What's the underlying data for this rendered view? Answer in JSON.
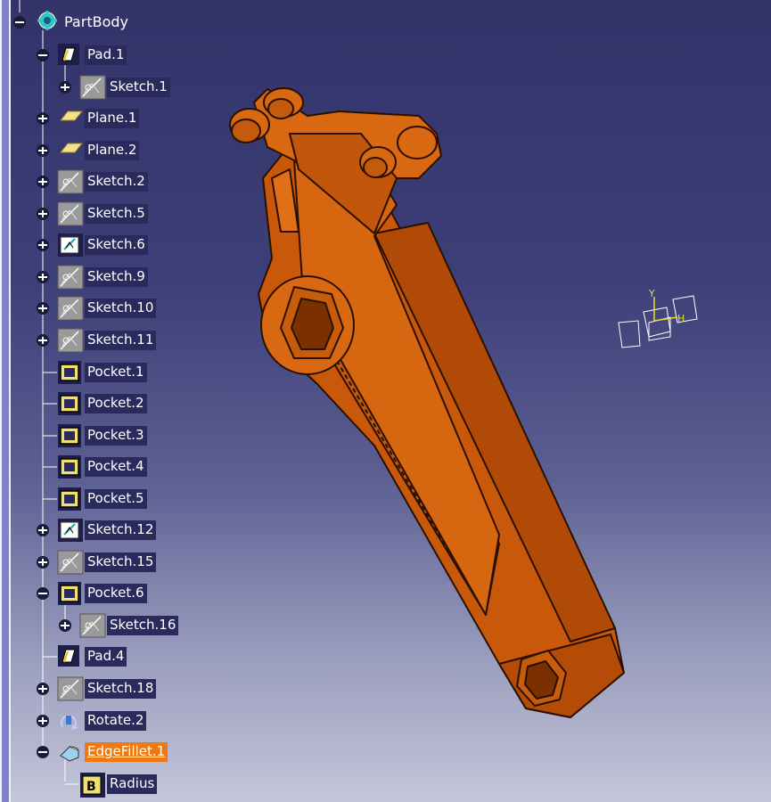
{
  "tree": {
    "root": {
      "label": "PartBody",
      "icon": "partbody-icon"
    },
    "nodes": [
      {
        "label": "Pad.1",
        "icon": "pad-icon",
        "expander": "minus"
      },
      {
        "label": "Sketch.1",
        "icon": "sketch-icon",
        "expander": "plus"
      },
      {
        "label": "Plane.1",
        "icon": "plane-icon",
        "expander": "plus"
      },
      {
        "label": "Plane.2",
        "icon": "plane-icon",
        "expander": "plus"
      },
      {
        "label": "Sketch.2",
        "icon": "sketch-icon",
        "expander": "plus"
      },
      {
        "label": "Sketch.5",
        "icon": "sketch-icon",
        "expander": "plus"
      },
      {
        "label": "Sketch.6",
        "icon": "sketch-edit-icon",
        "expander": "plus"
      },
      {
        "label": "Sketch.9",
        "icon": "sketch-icon",
        "expander": "plus"
      },
      {
        "label": "Sketch.10",
        "icon": "sketch-icon",
        "expander": "plus"
      },
      {
        "label": "Sketch.11",
        "icon": "sketch-icon",
        "expander": "plus"
      },
      {
        "label": "Pocket.1",
        "icon": "pocket-icon",
        "expander": "none"
      },
      {
        "label": "Pocket.2",
        "icon": "pocket-icon",
        "expander": "none"
      },
      {
        "label": "Pocket.3",
        "icon": "pocket-icon",
        "expander": "none"
      },
      {
        "label": "Pocket.4",
        "icon": "pocket-icon",
        "expander": "none"
      },
      {
        "label": "Pocket.5",
        "icon": "pocket-icon",
        "expander": "none"
      },
      {
        "label": "Sketch.12",
        "icon": "sketch-edit-icon",
        "expander": "plus"
      },
      {
        "label": "Sketch.15",
        "icon": "sketch-icon",
        "expander": "plus"
      },
      {
        "label": "Pocket.6",
        "icon": "pocket-icon",
        "expander": "minus"
      },
      {
        "label": "Sketch.16",
        "icon": "sketch-icon",
        "expander": "plus"
      },
      {
        "label": "Pad.4",
        "icon": "pad-icon",
        "expander": "none"
      },
      {
        "label": "Sketch.18",
        "icon": "sketch-icon",
        "expander": "plus"
      },
      {
        "label": "Rotate.2",
        "icon": "rotate-icon",
        "expander": "plus"
      },
      {
        "label": "EdgeFillet.1",
        "icon": "edge-fillet-icon",
        "expander": "minus",
        "selected": true
      },
      {
        "label": "Radius",
        "icon": "radius-parameter-icon",
        "expander": "none"
      }
    ]
  },
  "compass": {
    "axis_labels": [
      "Y",
      "H"
    ]
  },
  "colors": {
    "part_orange": "#d2600a",
    "label_bg": "#2a2a5c",
    "selected_bg": "#f07810",
    "axis_yellow": "#e8e020"
  }
}
